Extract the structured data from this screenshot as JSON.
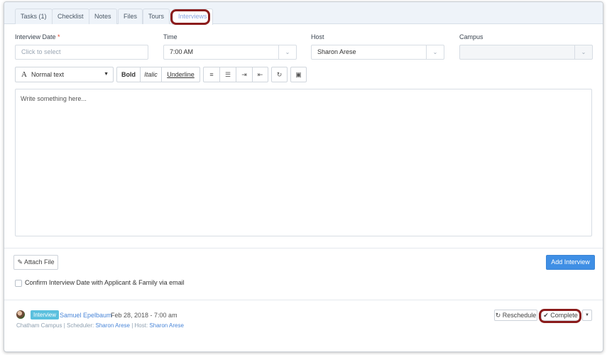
{
  "tabs": [
    {
      "label": "Tasks (1)"
    },
    {
      "label": "Checklist"
    },
    {
      "label": "Notes"
    },
    {
      "label": "Files"
    },
    {
      "label": "Tours"
    },
    {
      "label": "Interviews"
    }
  ],
  "form": {
    "date_label": "Interview Date",
    "required_mark": "*",
    "date_placeholder": "Click to select",
    "time_label": "Time",
    "time_value": "7:00 AM",
    "host_label": "Host",
    "host_value": "Sharon Arese",
    "campus_label": "Campus",
    "campus_value": ""
  },
  "toolbar": {
    "format_label": "Normal text",
    "bold": "Bold",
    "italic": "Italic",
    "underline": "Underline"
  },
  "editor": {
    "placeholder": "Write something here..."
  },
  "actions": {
    "attach_label": "Attach File",
    "add_label": "Add Interview",
    "confirm_label": "Confirm Interview Date with Applicant & Family via email"
  },
  "interview": {
    "badge": "Interview",
    "name": "Samuel Epelbaum",
    "datetime": "Feb 28, 2018 - 7:00 am",
    "campus": "Chatham Campus",
    "scheduler_label": "Scheduler:",
    "scheduler": "Sharon Arese",
    "host_label": "Host:",
    "host": "Sharon Arese",
    "reschedule_label": "Reschedule",
    "complete_label": "Complete"
  },
  "colors": {
    "accent": "#3f8fe5",
    "highlight": "#8b1c1c",
    "badge": "#5bc0de"
  }
}
